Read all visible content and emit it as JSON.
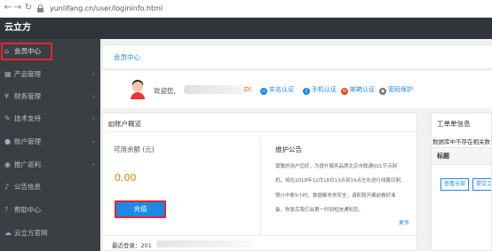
{
  "browser": {
    "url": "yunlifang.cn/user/logininfo.html",
    "back_icon": "arrow-left-icon",
    "forward_icon": "arrow-right-icon",
    "refresh_icon": "refresh-icon",
    "lock_icon": "lock-icon"
  },
  "app": {
    "brand": "云立方"
  },
  "sidebar": {
    "items": [
      {
        "label": "会员中心",
        "icon": "home-icon",
        "glyph": "⌂",
        "chevron": ""
      },
      {
        "label": "产品管理",
        "icon": "grid-icon",
        "glyph": "▦",
        "chevron": "›"
      },
      {
        "label": "财务管理",
        "icon": "yen-icon",
        "glyph": "¥",
        "chevron": "›"
      },
      {
        "label": "技术支持",
        "icon": "wrench-icon",
        "glyph": "✎",
        "chevron": "›"
      },
      {
        "label": "账户管理",
        "icon": "user-icon",
        "glyph": "●",
        "chevron": "›"
      },
      {
        "label": "推广返利",
        "icon": "users-icon",
        "glyph": "◉",
        "chevron": "›"
      },
      {
        "label": "公告信息",
        "icon": "bell-icon",
        "glyph": "♪",
        "chevron": ""
      },
      {
        "label": "帮助中心",
        "icon": "help-icon",
        "glyph": "?",
        "chevron": ""
      },
      {
        "label": "云立方官网",
        "icon": "cloud-icon",
        "glyph": "☁",
        "chevron": ""
      }
    ]
  },
  "breadcrumb": {
    "label": "会员中心"
  },
  "user": {
    "welcome": "欢迎您,",
    "name_tail": "D)",
    "auth": [
      {
        "label": "实名认证",
        "icon": "id-card-icon",
        "color": "#1e88e5"
      },
      {
        "label": "手机认证",
        "icon": "phone-icon",
        "color": "#1e88e5"
      },
      {
        "label": "邮箱认证",
        "icon": "mail-icon",
        "color": "#e24a1a"
      },
      {
        "label": "密码保护",
        "icon": "shield-icon",
        "color": "#777777"
      }
    ]
  },
  "account": {
    "title": "账户概览",
    "title_icon": "bar-chart-icon",
    "balance_label": "可用余额 (元)",
    "balance_value": "0.00",
    "recharge_label": "充值",
    "notice_title": "维护公告",
    "notice_lines": [
      "尊敬的用户您好，为提升服务品质北京市联通001节点网",
      "机，将在2018年12月18日13点到19点左右进行线路切割,",
      "预计中断5小时，数据都非常安全，请和我开展前做好准",
      "备，恢复后我们会第一时间短信通知您。"
    ],
    "more": "更多",
    "last_login_label": "最近登录：201"
  },
  "ticket": {
    "title": "工单单信息",
    "message": "数据库中不存在相关数",
    "header": "标题",
    "view_all": "查看全部",
    "submit": "提交工"
  },
  "colors": {
    "accent": "#1e88e5",
    "highlight": "#e0282a",
    "balance": "#f07b00",
    "sidebar": "#3a3f44",
    "topbar": "#2f353b"
  }
}
